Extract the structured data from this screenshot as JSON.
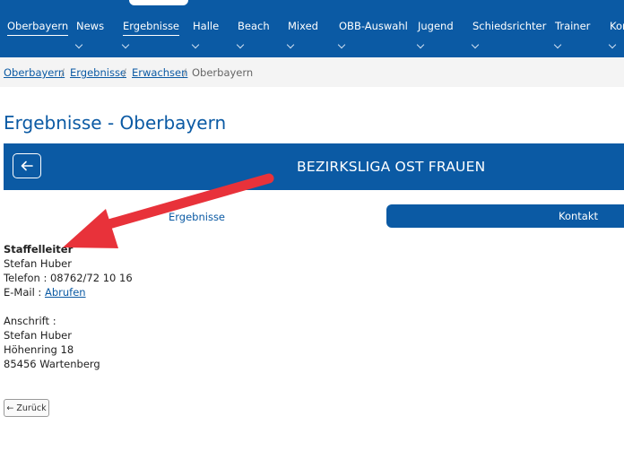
{
  "nav": {
    "items": [
      {
        "label": "Oberbayern",
        "active": true,
        "chevron": false
      },
      {
        "label": "News",
        "active": false,
        "chevron": true
      },
      {
        "label": "Ergebnisse",
        "active": true,
        "chevron": true
      },
      {
        "label": "Halle",
        "active": false,
        "chevron": true
      },
      {
        "label": "Beach",
        "active": false,
        "chevron": true
      },
      {
        "label": "Mixed",
        "active": false,
        "chevron": true
      },
      {
        "label": "OBB-Auswahl",
        "active": false,
        "chevron": true
      },
      {
        "label": "Jugend",
        "active": false,
        "chevron": true
      },
      {
        "label": "Schiedsrichter",
        "active": false,
        "chevron": true
      },
      {
        "label": "Trainer",
        "active": false,
        "chevron": true
      },
      {
        "label": "Kon",
        "active": false,
        "chevron": true
      }
    ]
  },
  "breadcrumb": {
    "items": [
      "Oberbayern",
      "Ergebnisse",
      "Erwachsen"
    ],
    "current": "Oberbayern",
    "separator": "/"
  },
  "page": {
    "title": "Ergebnisse - Oberbayern"
  },
  "banner": {
    "title": "BEZIRKSLIGA OST FRAUEN",
    "back_icon": "arrow-left-icon"
  },
  "tabs": {
    "left": "Ergebnisse",
    "right": "Kontakt"
  },
  "contact": {
    "heading": "Staffelleiter",
    "name": "Stefan Huber",
    "phone": "Telefon : 08762/72 10 16",
    "email_label": "E-Mail :",
    "email_link": "Abrufen",
    "address_label": "Anschrift :",
    "address_name": "Stefan Huber",
    "street": "Höhenring 18",
    "city": "85456 Wartenberg"
  },
  "back_button": {
    "label": "← Zurück"
  },
  "colors": {
    "primary": "#0b5aa4",
    "annotation_arrow": "#e8323a"
  }
}
